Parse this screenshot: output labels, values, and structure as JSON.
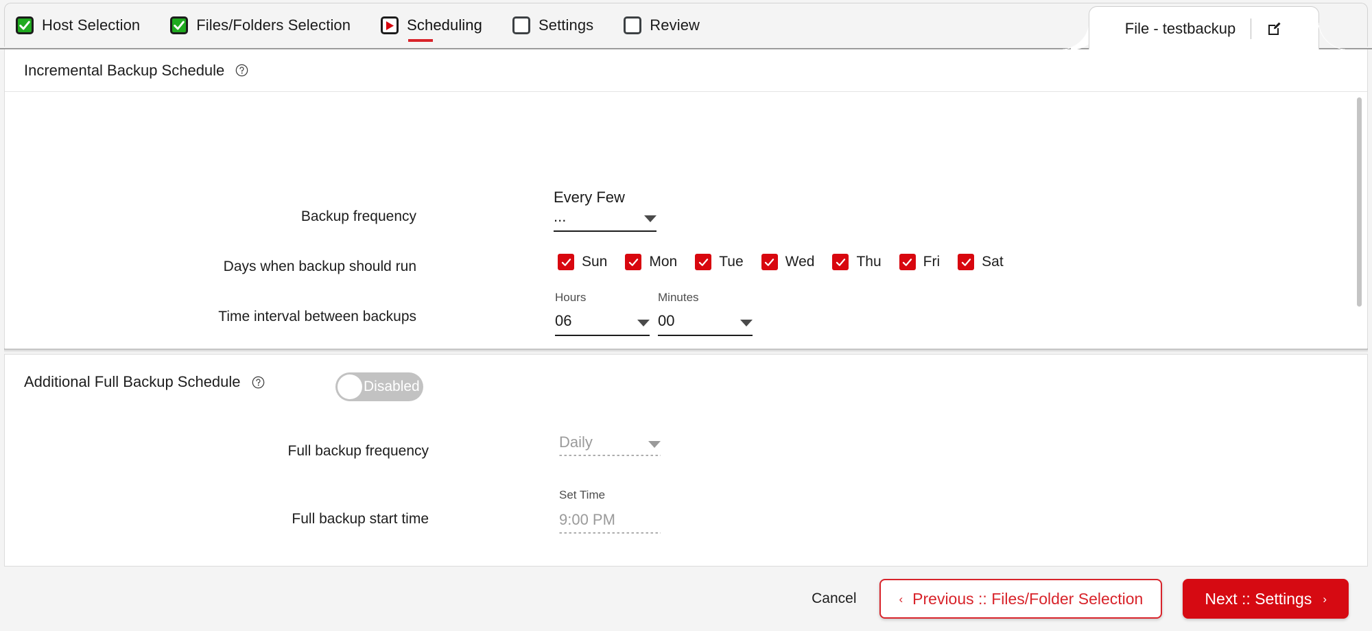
{
  "wizard": {
    "steps": [
      {
        "label": "Host Selection",
        "state": "done",
        "icon": "checkbox-checked-icon"
      },
      {
        "label": "Files/Folders Selection",
        "state": "done",
        "icon": "checkbox-checked-icon"
      },
      {
        "label": "Scheduling",
        "state": "active",
        "icon": "play-icon"
      },
      {
        "label": "Settings",
        "state": "todo",
        "icon": "checkbox-empty-icon"
      },
      {
        "label": "Review",
        "state": "todo",
        "icon": "checkbox-empty-icon"
      }
    ]
  },
  "file_tab": {
    "title": "File - testbackup",
    "edit_icon": "edit-pencil-icon"
  },
  "incremental": {
    "title": "Incremental Backup Schedule",
    "help_icon": "help-circle-icon",
    "backup_frequency": {
      "label": "Backup frequency",
      "value": "Every Few ...",
      "caret_icon": "chevron-down-icon"
    },
    "days": {
      "label": "Days when backup should run",
      "items": [
        {
          "label": "Sun",
          "checked": true
        },
        {
          "label": "Mon",
          "checked": true
        },
        {
          "label": "Tue",
          "checked": true
        },
        {
          "label": "Wed",
          "checked": true
        },
        {
          "label": "Thu",
          "checked": true
        },
        {
          "label": "Fri",
          "checked": true
        },
        {
          "label": "Sat",
          "checked": true
        }
      ]
    },
    "interval": {
      "label": "Time interval between backups",
      "hours_label": "Hours",
      "hours_value": "06",
      "minutes_label": "Minutes",
      "minutes_value": "00"
    }
  },
  "full_backup": {
    "title": "Additional Full Backup Schedule",
    "help_icon": "help-circle-icon",
    "toggle": {
      "state_label": "Disabled",
      "enabled": false
    },
    "frequency": {
      "label": "Full backup frequency",
      "value": "Daily",
      "disabled": true
    },
    "start_time": {
      "label": "Full backup start time",
      "sub_label": "Set Time",
      "value": "9:00 PM",
      "disabled": true
    }
  },
  "footer": {
    "cancel": "Cancel",
    "previous": "Previous :: Files/Folder Selection",
    "previous_arrow": "‹",
    "next": "Next :: Settings",
    "next_arrow": "›"
  },
  "colors": {
    "brand_red": "#d60a12",
    "accent_red": "#d8232a",
    "done_green": "#1faa1f",
    "panel_bg": "#ffffff",
    "page_bg": "#f4f4f4"
  }
}
